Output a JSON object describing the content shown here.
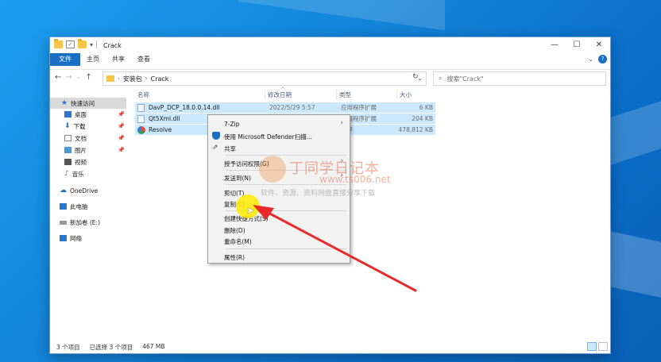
{
  "window": {
    "title": "Crack",
    "controls": {
      "minimize": "—",
      "maximize": "☐",
      "close": "✕"
    }
  },
  "ribbon": {
    "tabs": [
      "文件",
      "主页",
      "共享",
      "查看"
    ],
    "expand": "⌄",
    "help": "?"
  },
  "address": {
    "back": "←",
    "forward": "→",
    "recent": "⌄",
    "up": "↑",
    "crumbs": [
      "安装包",
      "Crack"
    ],
    "search_placeholder": "搜索\"Crack\""
  },
  "nav": {
    "items": [
      {
        "label": "快速访问",
        "icon": "star-icon",
        "color": "#2c77cc"
      },
      {
        "label": "桌面",
        "icon": "desktop-icon",
        "color": "#2c77cc",
        "pinned": true
      },
      {
        "label": "下载",
        "icon": "download-icon",
        "color": "#2c77cc",
        "pinned": true
      },
      {
        "label": "文档",
        "icon": "document-icon",
        "color": "#8a8a8a",
        "pinned": true
      },
      {
        "label": "图片",
        "icon": "picture-icon",
        "color": "#2c77cc",
        "pinned": true
      },
      {
        "label": "视频",
        "icon": "video-icon",
        "color": "#555555"
      },
      {
        "label": "音乐",
        "icon": "music-icon",
        "color": "#2c77cc"
      },
      {
        "label": "OneDrive",
        "icon": "cloud-icon",
        "color": "#1a6fc4"
      },
      {
        "label": "此电脑",
        "icon": "computer-icon",
        "color": "#2c77cc"
      },
      {
        "label": "新加卷 (E:)",
        "icon": "drive-icon",
        "color": "#777777"
      },
      {
        "label": "网络",
        "icon": "network-icon",
        "color": "#2c77cc"
      }
    ]
  },
  "columns": {
    "name": "名称",
    "date": "修改日期",
    "type": "类型",
    "size": "大小"
  },
  "files": [
    {
      "name": "DavP_DCP_18.0.0.14.dll",
      "date": "2022/5/29 5:57",
      "type": "应用程序扩展",
      "size": "6 KB"
    },
    {
      "name": "Qt5Xml.dll",
      "date": "",
      "type": "应用程序扩展",
      "size": "204 KB"
    },
    {
      "name": "Resolve",
      "date": "",
      "type": "程序",
      "size": "478,812 KB"
    }
  ],
  "context_menu": {
    "items": [
      "7-Zip",
      "使用 Microsoft Defender扫描...",
      "共享",
      "授予访问权限(G)",
      "发送到(N)",
      "剪切(T)",
      "复制(C)",
      "创建快捷方式(S)",
      "删除(D)",
      "重命名(M)",
      "属性(R)"
    ]
  },
  "status": {
    "count": "3 个项目",
    "selected": "已选择 3 个项目",
    "size": "467 MB"
  },
  "watermark": {
    "title": "丁同学日记本",
    "url": "www.ts006.net",
    "subtitle": "软件、资源、资料网盘直接分享下载"
  },
  "colors": {
    "accent": "#1a6fc4",
    "selection": "#cce8ff",
    "annotation_arrow": "#e82a2a",
    "cursor_halo": "#ffeb00"
  }
}
